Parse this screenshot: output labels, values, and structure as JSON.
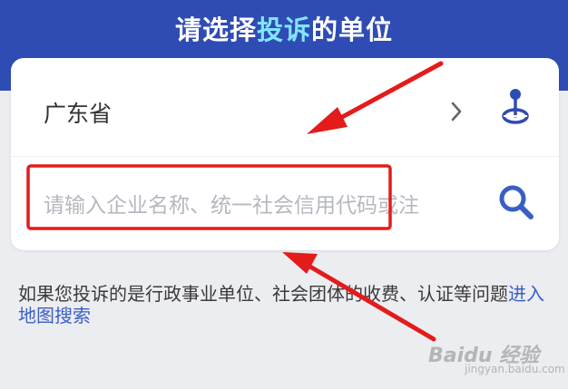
{
  "header": {
    "title_part1": "请选择",
    "title_highlight": "投诉",
    "title_part2": "的单位"
  },
  "province_selector": {
    "label": "广东省"
  },
  "search": {
    "placeholder": "请输入企业名称、统一社会信用代码或注"
  },
  "hint": {
    "text": "如果您投诉的是行政事业单位、社会团体的收费、认证等问题",
    "link": "进入地图搜索"
  },
  "watermark": {
    "brand": "Baidu 经验",
    "url": "jingyan.baidu.com"
  },
  "colors": {
    "header_bg": "#2f4cb4",
    "title_highlight": "#7fe6ff",
    "accent_blue": "#3a5fc4",
    "page_bg": "#ecedf1",
    "annotation_red": "#e41b1b"
  },
  "icons": {
    "chevron": "chevron-right-icon",
    "location": "location-pin-icon",
    "search": "search-icon"
  }
}
